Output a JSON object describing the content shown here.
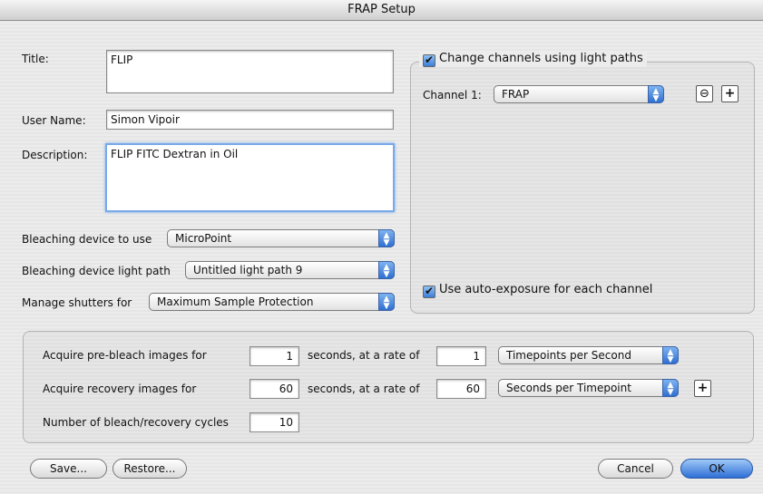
{
  "window": {
    "title": "FRAP Setup"
  },
  "form": {
    "title_label": "Title:",
    "title_value": "FLIP",
    "username_label": "User Name:",
    "username_value": "Simon Vipoir",
    "description_label": "Description:",
    "description_value": "FLIP FITC Dextran in Oil"
  },
  "bleach": {
    "device_label": "Bleaching device to use",
    "device_value": "MicroPoint",
    "lightpath_label": "Bleaching device light path",
    "lightpath_value": "Untitled light path 9",
    "shutters_label": "Manage shutters for",
    "shutters_value": "Maximum Sample Protection"
  },
  "channels": {
    "change_label": "Change channels using light paths",
    "change_checked": true,
    "channel1_label": "Channel 1:",
    "channel1_value": "FRAP",
    "autoexposure_label": "Use auto-exposure for each channel",
    "autoexposure_checked": true
  },
  "acquire": {
    "prebleach_label": "Acquire pre-bleach images for",
    "prebleach_value": "1",
    "prebleach_mid": "seconds, at a rate of",
    "prebleach_rate": "1",
    "prebleach_unit": "Timepoints per Second",
    "recovery_label": "Acquire recovery images for",
    "recovery_value": "60",
    "recovery_mid": "seconds, at a rate of",
    "recovery_rate": "60",
    "recovery_unit": "Seconds per Timepoint",
    "cycles_label": "Number of bleach/recovery cycles",
    "cycles_value": "10"
  },
  "buttons": {
    "save": "Save...",
    "restore": "Restore...",
    "cancel": "Cancel",
    "ok": "OK"
  },
  "icons": {
    "plus": "+",
    "remove": "⊖",
    "check": "✔",
    "updown": "▲▼"
  }
}
